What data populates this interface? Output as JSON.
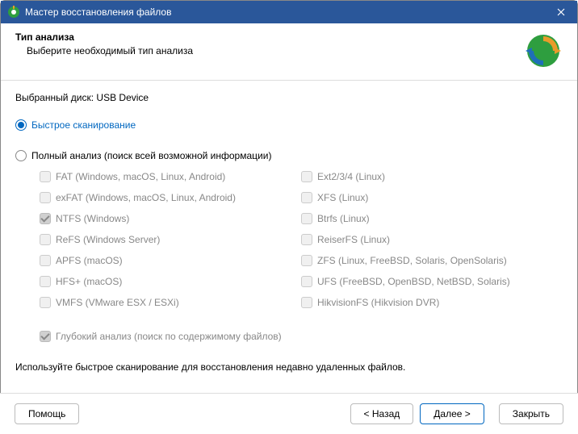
{
  "titlebar": {
    "title": "Мастер восстановления файлов"
  },
  "header": {
    "title": "Тип анализа",
    "subtitle": "Выберите необходимый тип анализа"
  },
  "selected_disk_label": "Выбранный диск:",
  "selected_disk_value": "USB Device",
  "options": {
    "quick": "Быстрое сканирование",
    "full": "Полный анализ (поиск всей возможной информации)"
  },
  "filesystems_left": [
    "FAT (Windows, macOS, Linux, Android)",
    "exFAT (Windows, macOS, Linux, Android)",
    "NTFS (Windows)",
    "ReFS (Windows Server)",
    "APFS (macOS)",
    "HFS+ (macOS)",
    "VMFS (VMware ESX / ESXi)"
  ],
  "filesystems_right": [
    "Ext2/3/4 (Linux)",
    "XFS (Linux)",
    "Btrfs (Linux)",
    "ReiserFS (Linux)",
    "ZFS (Linux, FreeBSD, Solaris, OpenSolaris)",
    "UFS (FreeBSD, OpenBSD, NetBSD, Solaris)",
    "HikvisionFS (Hikvision DVR)"
  ],
  "deep_analysis": "Глубокий анализ (поиск по содержимому файлов)",
  "hint": "Используйте быстрое сканирование для восстановления недавно удаленных файлов.",
  "buttons": {
    "help": "Помощь",
    "back": "< Назад",
    "next": "Далее >",
    "close": "Закрыть"
  }
}
